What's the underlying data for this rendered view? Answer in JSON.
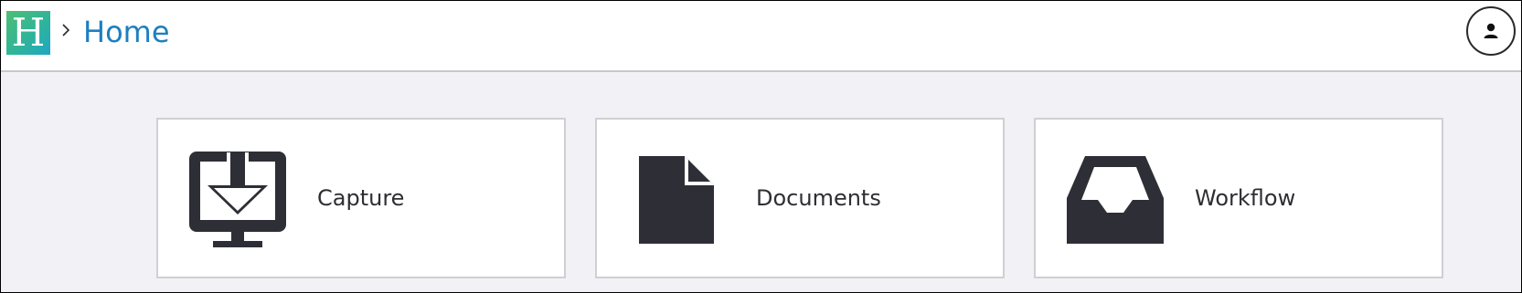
{
  "header": {
    "logo_letter": "H",
    "breadcrumb_title": "Home",
    "icons": {
      "separator": "chevron-right-icon",
      "user": "user-icon"
    },
    "colors": {
      "title": "#1d7fc1",
      "logo_start": "#4dbf72",
      "logo_end": "#1ea6c4"
    }
  },
  "tiles": [
    {
      "label": "Capture",
      "icon": "monitor-download-icon"
    },
    {
      "label": "Documents",
      "icon": "document-icon"
    },
    {
      "label": "Workflow",
      "icon": "inbox-tray-icon"
    }
  ],
  "colors": {
    "page_bg": "#f2f2f6",
    "icon": "#2e2e36",
    "tile_border": "#cfcfd4"
  }
}
